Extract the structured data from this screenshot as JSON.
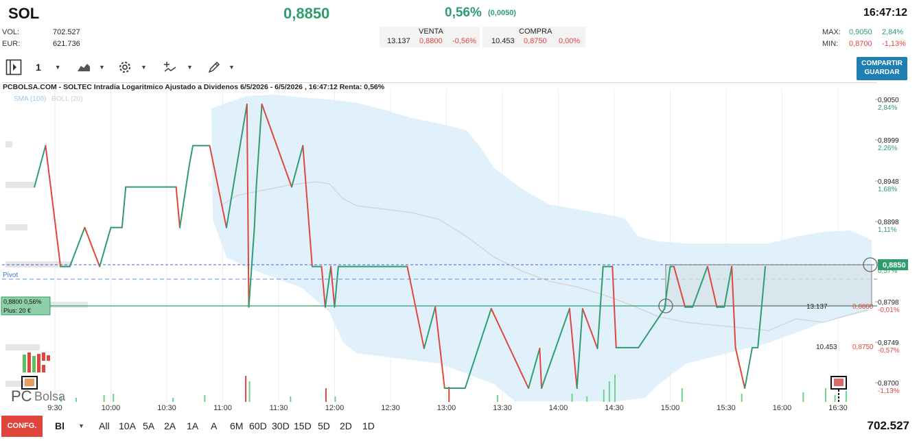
{
  "header": {
    "ticker": "SOL",
    "price": "0,8850",
    "change_pct": "0,56%",
    "change_abs": "(0,0050)",
    "time": "16:47:12",
    "vol_label": "VOL:",
    "vol_value": "702.527",
    "eur_label": "EUR:",
    "eur_value": "621.736",
    "max_label": "MAX:",
    "max_price": "0,9050",
    "max_pct": "2,84%",
    "min_label": "MIN:",
    "min_price": "0,8700",
    "min_pct": "-1,13%"
  },
  "book": {
    "sell_label": "VENTA",
    "sell_qty": "13.137",
    "sell_price": "0,8800",
    "sell_pct": "-0,56%",
    "buy_label": "COMPRA",
    "buy_qty": "10.453",
    "buy_price": "0,8750",
    "buy_pct": "0,00%"
  },
  "toolbar": {
    "interval_value": "1",
    "share_line1": "COMPARTIR",
    "share_line2": "GUARDAR",
    "icons": [
      "panel-toggle-icon",
      "area-chart-icon",
      "gear-icon",
      "indicators-icon",
      "drawing-pen-icon"
    ]
  },
  "chart": {
    "title": "PCBOLSA.COM - SOLTEC Intradia Logaritmico Ajustado a Dividenos 6/5/2026 - 6/5/2026 , 16:47:12 Renta: 0,56%",
    "legend_sma": "SMA (100)",
    "legend_boll": "BOLL (20)",
    "pivot_label": "Pivot",
    "pos_label_1": "0,8800  0,56%",
    "pos_label_2": "Plus: 20 €",
    "last_price_tag": "0,8850",
    "ask_qty": "13.137",
    "ask_price_tag": "0,8800",
    "bid_qty": "10.453",
    "bid_price_tag": "0,8750",
    "logo_text_a": "PC",
    "logo_text_b": "Bolsa",
    "colors": {
      "up": "#2e9c6e",
      "down": "#e0453b",
      "band": "#dbeefb",
      "pivot": "#5a8fd8",
      "last": "#4b5bd6"
    }
  },
  "chart_data": {
    "type": "line",
    "title": "PCBOLSA.COM - SOLTEC Intradia Logaritmico Ajustado a Dividenos 6/5/2026 - 6/5/2026 , 16:47:12 Renta: 0,56%",
    "x_ticks": [
      "9:30",
      "10:00",
      "10:30",
      "11:00",
      "11:30",
      "12:00",
      "12:30",
      "13:00",
      "13:30",
      "14:00",
      "14:30",
      "15:00",
      "15:30",
      "16:00",
      "16:30"
    ],
    "y_ticks": [
      {
        "price": "0,9050",
        "pct": "2,84%"
      },
      {
        "price": "0,8999",
        "pct": "2,26%"
      },
      {
        "price": "0,8948",
        "pct": "1,68%"
      },
      {
        "price": "0,8898",
        "pct": "1,11%"
      },
      {
        "price": "0,8850",
        "pct": "0,57%"
      },
      {
        "price": "0,8798",
        "pct": "-0,01%"
      },
      {
        "price": "0,8749",
        "pct": "-0,57%"
      },
      {
        "price": "0,8700",
        "pct": "-1,13%"
      }
    ],
    "ylim": [
      0.87,
      0.905
    ],
    "reference_price": 0.88,
    "pivot": 0.8832,
    "series": [
      {
        "name": "SOL",
        "points": [
          [
            "9:19",
            0.8948
          ],
          [
            "9:25",
            0.8999
          ],
          [
            "9:33",
            0.885
          ],
          [
            "9:38",
            0.885
          ],
          [
            "9:46",
            0.8898
          ],
          [
            "9:54",
            0.885
          ],
          [
            "10:00",
            0.8898
          ],
          [
            "10:06",
            0.8898
          ],
          [
            "10:08",
            0.8948
          ],
          [
            "10:35",
            0.8948
          ],
          [
            "10:37",
            0.8898
          ],
          [
            "10:42",
            0.8974
          ],
          [
            "10:44",
            0.8999
          ],
          [
            "10:53",
            0.8999
          ],
          [
            "11:02",
            0.8898
          ],
          [
            "11:13",
            0.905
          ],
          [
            "11:14",
            0.88
          ],
          [
            "11:17",
            0.8898
          ],
          [
            "11:18",
            0.8948
          ],
          [
            "11:21",
            0.905
          ],
          [
            "11:37",
            0.8948
          ],
          [
            "11:43",
            0.8999
          ],
          [
            "11:48",
            0.885
          ],
          [
            "11:53",
            0.885
          ],
          [
            "11:55",
            0.88
          ],
          [
            "11:58",
            0.885
          ],
          [
            "12:00",
            0.88
          ],
          [
            "12:02",
            0.885
          ],
          [
            "12:39",
            0.885
          ],
          [
            "12:48",
            0.8749
          ],
          [
            "12:54",
            0.88
          ],
          [
            "12:59",
            0.87
          ],
          [
            "13:10",
            0.87
          ],
          [
            "13:24",
            0.8798
          ],
          [
            "13:44",
            0.87
          ],
          [
            "13:50",
            0.8749
          ],
          [
            "13:51",
            0.87
          ],
          [
            "14:06",
            0.8798
          ],
          [
            "14:10",
            0.87
          ],
          [
            "14:13",
            0.8798
          ],
          [
            "14:21",
            0.8749
          ],
          [
            "14:24",
            0.885
          ],
          [
            "14:29",
            0.885
          ],
          [
            "14:31",
            0.875
          ],
          [
            "14:43",
            0.875
          ],
          [
            "14:57",
            0.8798
          ],
          [
            "15:00",
            0.885
          ],
          [
            "15:02",
            0.885
          ],
          [
            "15:08",
            0.88
          ],
          [
            "15:12",
            0.88
          ],
          [
            "15:20",
            0.885
          ],
          [
            "15:25",
            0.88
          ],
          [
            "15:29",
            0.88
          ],
          [
            "15:33",
            0.885
          ],
          [
            "15:35",
            0.875
          ],
          [
            "15:40",
            0.87
          ],
          [
            "15:44",
            0.875
          ],
          [
            "15:47",
            0.875
          ],
          [
            "15:51",
            0.885
          ]
        ]
      },
      {
        "name": "SMA (100)",
        "values": "shown"
      },
      {
        "name": "BOLL (20)",
        "values": "shown"
      }
    ],
    "legend": "top-left",
    "grid": true
  },
  "bottom": {
    "config_label": "CONFG.",
    "type_value": "Bl",
    "periods": [
      "All",
      "10A",
      "5A",
      "2A",
      "1A",
      "A",
      "6M",
      "60D",
      "30D",
      "15D",
      "5D",
      "2D",
      "1D"
    ],
    "volume_total": "702.527"
  }
}
